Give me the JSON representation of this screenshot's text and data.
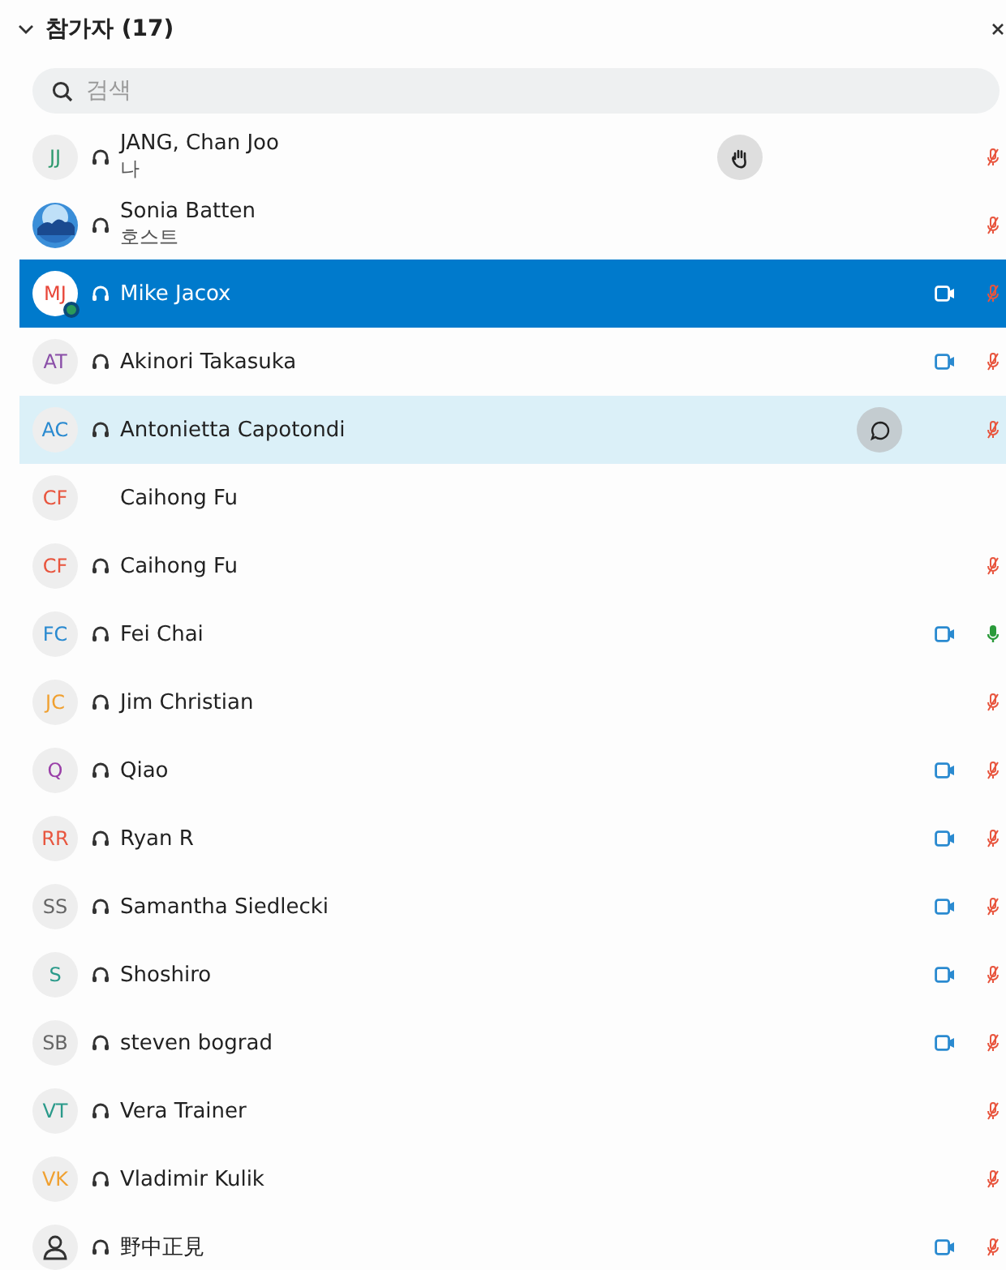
{
  "header": {
    "title": "참가자 (17)",
    "expanded": true
  },
  "search": {
    "placeholder": "검색"
  },
  "participants": [
    {
      "avatar": {
        "kind": "initials",
        "initials": "JJ",
        "color": "#2e9a6e"
      },
      "headset": true,
      "name": "JANG, Chan Joo",
      "subtitle": "나",
      "hand_raised": true,
      "mic_muted": true,
      "selected": false,
      "highlighted": false
    },
    {
      "headset": true,
      "name": "Sonia Batten",
      "subtitle": "호스트",
      "mic_muted": true,
      "selected": false,
      "highlighted": false
    },
    {
      "avatar": {
        "kind": "initials",
        "initials": "MJ",
        "color": "#e8473a",
        "badge": true
      },
      "headset": true,
      "name": "Mike Jacox",
      "mic_muted": true,
      "video": true,
      "selected": true,
      "highlighted": false
    },
    {
      "avatar": {
        "kind": "initials",
        "initials": "AT",
        "color": "#8a4fa8"
      },
      "headset": true,
      "name": "Akinori Takasuka",
      "mic_muted": true,
      "video": true,
      "selected": false,
      "highlighted": false
    },
    {
      "avatar": {
        "kind": "initials",
        "initials": "AC",
        "color": "#2a8ad0"
      },
      "headset": true,
      "name": "Antonietta Capotondi",
      "chat_open": true,
      "mic_muted": true,
      "selected": false,
      "highlighted": true
    },
    {
      "avatar": {
        "kind": "initials",
        "initials": "CF",
        "color": "#e8553e"
      },
      "name": "Caihong Fu",
      "selected": false,
      "highlighted": false
    },
    {
      "avatar": {
        "kind": "initials",
        "initials": "CF",
        "color": "#e8553e"
      },
      "headset": true,
      "name": "Caihong Fu",
      "mic_muted": true,
      "selected": false,
      "highlighted": false
    },
    {
      "avatar": {
        "kind": "initials",
        "initials": "FC",
        "color": "#2a8ad0"
      },
      "headset": true,
      "name": "Fei Chai",
      "mic_muted": false,
      "video": true,
      "selected": false,
      "highlighted": false
    },
    {
      "avatar": {
        "kind": "initials",
        "initials": "JC",
        "color": "#f0a030"
      },
      "headset": true,
      "name": "Jim Christian",
      "mic_muted": true,
      "selected": false,
      "highlighted": false
    },
    {
      "avatar": {
        "kind": "initials",
        "initials": "Q",
        "color": "#9a3fa8"
      },
      "headset": true,
      "name": "Qiao",
      "mic_muted": true,
      "video": true,
      "selected": false,
      "highlighted": false
    },
    {
      "avatar": {
        "kind": "initials",
        "initials": "RR",
        "color": "#e8553e"
      },
      "headset": true,
      "name": "Ryan R",
      "mic_muted": true,
      "video": true,
      "selected": false,
      "highlighted": false
    },
    {
      "avatar": {
        "kind": "initials",
        "initials": "SS",
        "color": "#666666"
      },
      "headset": true,
      "name": "Samantha Siedlecki",
      "mic_muted": true,
      "video": true,
      "selected": false,
      "highlighted": false
    },
    {
      "avatar": {
        "kind": "initials",
        "initials": "S",
        "color": "#2a9a8a"
      },
      "headset": true,
      "name": "Shoshiro",
      "mic_muted": true,
      "video": true,
      "selected": false,
      "highlighted": false
    },
    {
      "avatar": {
        "kind": "initials",
        "initials": "SB",
        "color": "#666666"
      },
      "headset": true,
      "name": "steven bograd",
      "mic_muted": true,
      "video": true,
      "selected": false,
      "highlighted": false
    },
    {
      "avatar": {
        "kind": "initials",
        "initials": "VT",
        "color": "#2a9a8a"
      },
      "headset": true,
      "name": "Vera Trainer",
      "mic_muted": true,
      "selected": false,
      "highlighted": false
    },
    {
      "avatar": {
        "kind": "initials",
        "initials": "VK",
        "color": "#f0a030"
      },
      "headset": true,
      "name": "Vladimir Kulik",
      "mic_muted": true,
      "selected": false,
      "highlighted": false
    },
    {
      "avatar": {
        "kind": "person"
      },
      "headset": true,
      "name": "野中正見",
      "mic_muted": true,
      "video": true,
      "selected": false,
      "highlighted": false
    }
  ]
}
